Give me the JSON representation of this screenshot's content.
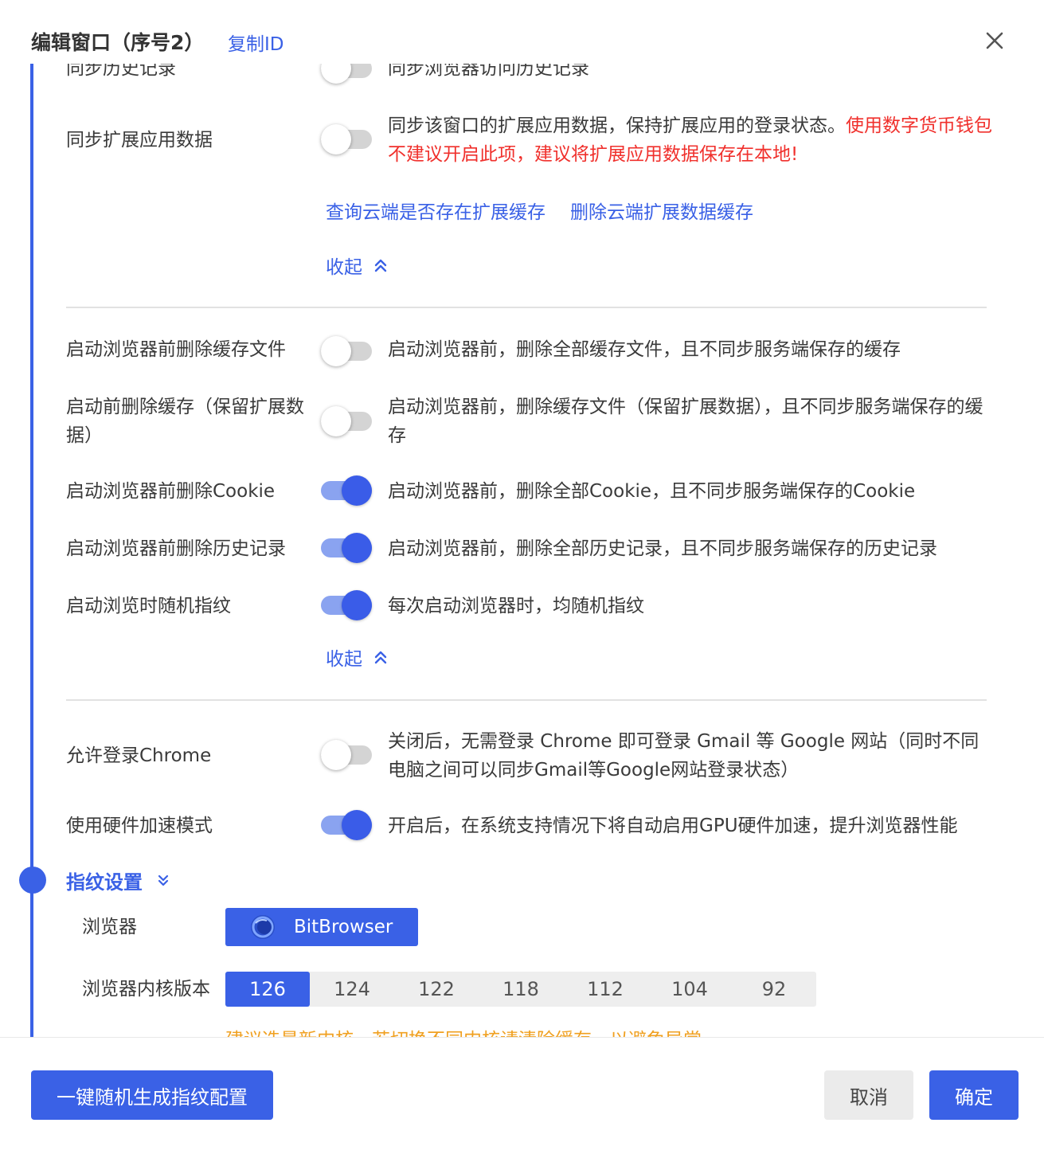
{
  "header": {
    "title": "编辑窗口（序号2）",
    "copy_id": "复制ID",
    "close_icon": "close-icon"
  },
  "settings_top": {
    "history_sync": {
      "label": "同步历史记录",
      "desc": "同步浏览器访问历史记录",
      "enabled": false
    },
    "ext_sync": {
      "label": "同步扩展应用数据",
      "desc": "同步该窗口的扩展应用数据，保持扩展应用的登录状态。",
      "warning": "使用数字货币钱包不建议开启此项，建议将扩展应用数据保存在本地!",
      "enabled": false
    },
    "link_query": "查询云端是否存在扩展缓存",
    "link_delete": "删除云端扩展数据缓存",
    "collapse": "收起"
  },
  "settings_cache": {
    "items": [
      {
        "label": "启动浏览器前删除缓存文件",
        "desc": "启动浏览器前，删除全部缓存文件，且不同步服务端保存的缓存",
        "enabled": false
      },
      {
        "label": "启动前删除缓存（保留扩展数据）",
        "desc": "启动浏览器前，删除缓存文件（保留扩展数据），且不同步服务端保存的缓存",
        "enabled": false
      },
      {
        "label": "启动浏览器前删除Cookie",
        "desc": "启动浏览器前，删除全部Cookie，且不同步服务端保存的Cookie",
        "enabled": true
      },
      {
        "label": "启动浏览器前删除历史记录",
        "desc": "启动浏览器前，删除全部历史记录，且不同步服务端保存的历史记录",
        "enabled": true
      },
      {
        "label": "启动浏览时随机指纹",
        "desc": "每次启动浏览器时，均随机指纹",
        "enabled": true
      }
    ],
    "collapse": "收起"
  },
  "settings_browser": {
    "items": [
      {
        "label": "允许登录Chrome",
        "desc": "关闭后，无需登录 Chrome 即可登录 Gmail 等 Google 网站（同时不同电脑之间可以同步Gmail等Google网站登录状态）",
        "enabled": false
      },
      {
        "label": "使用硬件加速模式",
        "desc": "开启后，在系统支持情况下将自动启用GPU硬件加速，提升浏览器性能",
        "enabled": true
      }
    ]
  },
  "fingerprint": {
    "section_title": "指纹设置",
    "browser_label": "浏览器",
    "browser_name": "BitBrowser",
    "kernel_label": "浏览器内核版本",
    "kernels": [
      "126",
      "124",
      "122",
      "118",
      "112",
      "104",
      "92"
    ],
    "kernel_selected": "126",
    "hint": "建议选最新内核，若切换不同内核请清除缓存，以避免异常"
  },
  "footer": {
    "random_btn": "一键随机生成指纹配置",
    "cancel_btn": "取消",
    "ok_btn": "确定"
  },
  "colors": {
    "accent": "#3a61e6",
    "warning": "#f0302c",
    "hint": "#f0a020"
  }
}
